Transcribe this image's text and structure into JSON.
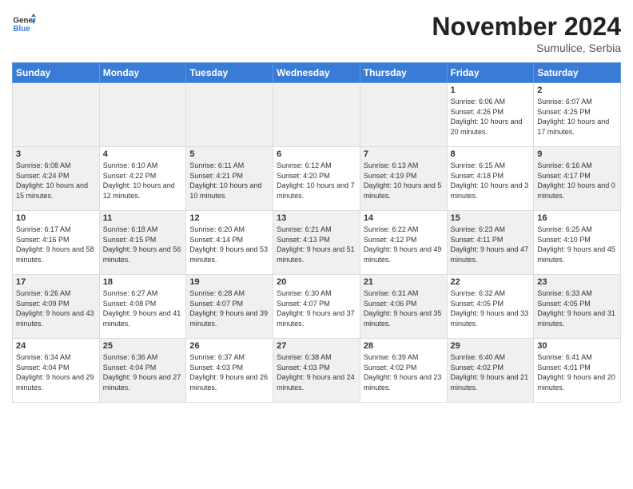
{
  "header": {
    "logo_line1": "General",
    "logo_line2": "Blue",
    "month": "November 2024",
    "location": "Sumulice, Serbia"
  },
  "days_of_week": [
    "Sunday",
    "Monday",
    "Tuesday",
    "Wednesday",
    "Thursday",
    "Friday",
    "Saturday"
  ],
  "weeks": [
    [
      {
        "day": "",
        "info": "",
        "shade": true
      },
      {
        "day": "",
        "info": "",
        "shade": true
      },
      {
        "day": "",
        "info": "",
        "shade": true
      },
      {
        "day": "",
        "info": "",
        "shade": true
      },
      {
        "day": "",
        "info": "",
        "shade": true
      },
      {
        "day": "1",
        "info": "Sunrise: 6:06 AM\nSunset: 4:26 PM\nDaylight: 10 hours and 20 minutes.",
        "shade": false
      },
      {
        "day": "2",
        "info": "Sunrise: 6:07 AM\nSunset: 4:25 PM\nDaylight: 10 hours and 17 minutes.",
        "shade": false
      }
    ],
    [
      {
        "day": "3",
        "info": "Sunrise: 6:08 AM\nSunset: 4:24 PM\nDaylight: 10 hours and 15 minutes.",
        "shade": true
      },
      {
        "day": "4",
        "info": "Sunrise: 6:10 AM\nSunset: 4:22 PM\nDaylight: 10 hours and 12 minutes.",
        "shade": false
      },
      {
        "day": "5",
        "info": "Sunrise: 6:11 AM\nSunset: 4:21 PM\nDaylight: 10 hours and 10 minutes.",
        "shade": true
      },
      {
        "day": "6",
        "info": "Sunrise: 6:12 AM\nSunset: 4:20 PM\nDaylight: 10 hours and 7 minutes.",
        "shade": false
      },
      {
        "day": "7",
        "info": "Sunrise: 6:13 AM\nSunset: 4:19 PM\nDaylight: 10 hours and 5 minutes.",
        "shade": true
      },
      {
        "day": "8",
        "info": "Sunrise: 6:15 AM\nSunset: 4:18 PM\nDaylight: 10 hours and 3 minutes.",
        "shade": false
      },
      {
        "day": "9",
        "info": "Sunrise: 6:16 AM\nSunset: 4:17 PM\nDaylight: 10 hours and 0 minutes.",
        "shade": true
      }
    ],
    [
      {
        "day": "10",
        "info": "Sunrise: 6:17 AM\nSunset: 4:16 PM\nDaylight: 9 hours and 58 minutes.",
        "shade": false
      },
      {
        "day": "11",
        "info": "Sunrise: 6:18 AM\nSunset: 4:15 PM\nDaylight: 9 hours and 56 minutes.",
        "shade": true
      },
      {
        "day": "12",
        "info": "Sunrise: 6:20 AM\nSunset: 4:14 PM\nDaylight: 9 hours and 53 minutes.",
        "shade": false
      },
      {
        "day": "13",
        "info": "Sunrise: 6:21 AM\nSunset: 4:13 PM\nDaylight: 9 hours and 51 minutes.",
        "shade": true
      },
      {
        "day": "14",
        "info": "Sunrise: 6:22 AM\nSunset: 4:12 PM\nDaylight: 9 hours and 49 minutes.",
        "shade": false
      },
      {
        "day": "15",
        "info": "Sunrise: 6:23 AM\nSunset: 4:11 PM\nDaylight: 9 hours and 47 minutes.",
        "shade": true
      },
      {
        "day": "16",
        "info": "Sunrise: 6:25 AM\nSunset: 4:10 PM\nDaylight: 9 hours and 45 minutes.",
        "shade": false
      }
    ],
    [
      {
        "day": "17",
        "info": "Sunrise: 6:26 AM\nSunset: 4:09 PM\nDaylight: 9 hours and 43 minutes.",
        "shade": true
      },
      {
        "day": "18",
        "info": "Sunrise: 6:27 AM\nSunset: 4:08 PM\nDaylight: 9 hours and 41 minutes.",
        "shade": false
      },
      {
        "day": "19",
        "info": "Sunrise: 6:28 AM\nSunset: 4:07 PM\nDaylight: 9 hours and 39 minutes.",
        "shade": true
      },
      {
        "day": "20",
        "info": "Sunrise: 6:30 AM\nSunset: 4:07 PM\nDaylight: 9 hours and 37 minutes.",
        "shade": false
      },
      {
        "day": "21",
        "info": "Sunrise: 6:31 AM\nSunset: 4:06 PM\nDaylight: 9 hours and 35 minutes.",
        "shade": true
      },
      {
        "day": "22",
        "info": "Sunrise: 6:32 AM\nSunset: 4:05 PM\nDaylight: 9 hours and 33 minutes.",
        "shade": false
      },
      {
        "day": "23",
        "info": "Sunrise: 6:33 AM\nSunset: 4:05 PM\nDaylight: 9 hours and 31 minutes.",
        "shade": true
      }
    ],
    [
      {
        "day": "24",
        "info": "Sunrise: 6:34 AM\nSunset: 4:04 PM\nDaylight: 9 hours and 29 minutes.",
        "shade": false
      },
      {
        "day": "25",
        "info": "Sunrise: 6:36 AM\nSunset: 4:04 PM\nDaylight: 9 hours and 27 minutes.",
        "shade": true
      },
      {
        "day": "26",
        "info": "Sunrise: 6:37 AM\nSunset: 4:03 PM\nDaylight: 9 hours and 26 minutes.",
        "shade": false
      },
      {
        "day": "27",
        "info": "Sunrise: 6:38 AM\nSunset: 4:03 PM\nDaylight: 9 hours and 24 minutes.",
        "shade": true
      },
      {
        "day": "28",
        "info": "Sunrise: 6:39 AM\nSunset: 4:02 PM\nDaylight: 9 hours and 23 minutes.",
        "shade": false
      },
      {
        "day": "29",
        "info": "Sunrise: 6:40 AM\nSunset: 4:02 PM\nDaylight: 9 hours and 21 minutes.",
        "shade": true
      },
      {
        "day": "30",
        "info": "Sunrise: 6:41 AM\nSunset: 4:01 PM\nDaylight: 9 hours and 20 minutes.",
        "shade": false
      }
    ]
  ]
}
